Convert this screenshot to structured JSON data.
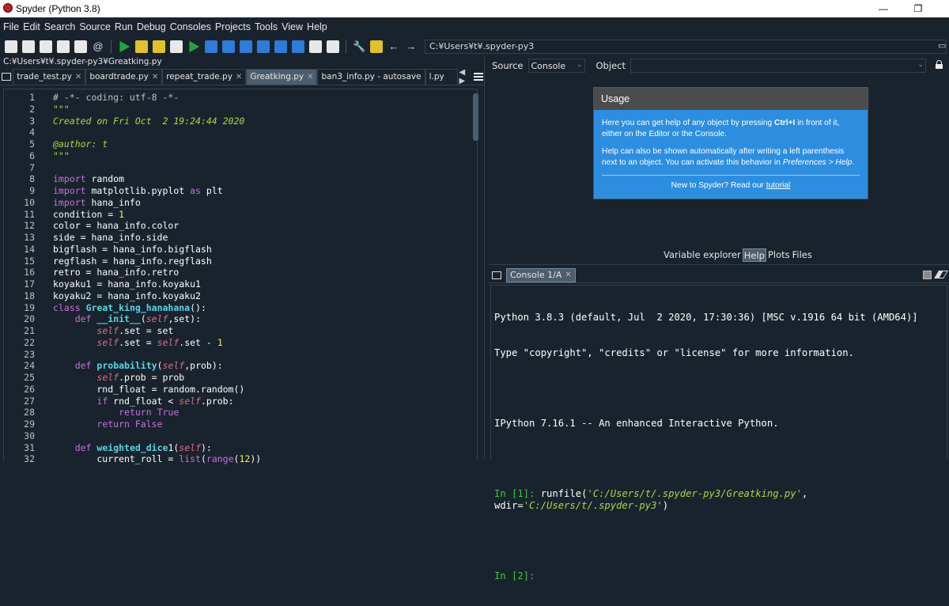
{
  "window": {
    "title": "Spyder (Python 3.8)"
  },
  "menu": [
    "File",
    "Edit",
    "Search",
    "Source",
    "Run",
    "Debug",
    "Consoles",
    "Projects",
    "Tools",
    "View",
    "Help"
  ],
  "toolbar": {
    "path": "C:¥Users¥t¥.spyder-py3"
  },
  "editor": {
    "filepath": "C:¥Users¥t¥.spyder-py3¥Greatking.py",
    "tabs": [
      {
        "label": "trade_test.py",
        "active": false
      },
      {
        "label": "boardtrade.py",
        "active": false
      },
      {
        "label": "repeat_trade.py",
        "active": false
      },
      {
        "label": "Greatking.py",
        "active": true
      },
      {
        "label": "ban3_info.py - autosave",
        "active": false
      },
      {
        "label": "l.py",
        "active": false
      }
    ],
    "line_numbers": [
      "1",
      "2",
      "3",
      "4",
      "5",
      "6",
      "7",
      "8",
      "9",
      "10",
      "11",
      "12",
      "13",
      "14",
      "15",
      "16",
      "17",
      "18",
      "19",
      "20",
      "21",
      "22",
      "23",
      "24",
      "25",
      "26",
      "27",
      "28",
      "29",
      "30",
      "31",
      "32"
    ],
    "code": [
      "# -*- coding: utf-8 -*-",
      "\"\"\"",
      "Created on Fri Oct  2 19:24:44 2020",
      "",
      "@author: t",
      "\"\"\"",
      "",
      "import random",
      "import matplotlib.pyplot as plt",
      "import hana_info",
      "condition = 1",
      "color = hana_info.color",
      "side = hana_info.side",
      "bigflash = hana_info.bigflash",
      "regflash = hana_info.regflash",
      "retro = hana_info.retro",
      "koyaku1 = hana_info.koyaku1",
      "koyaku2 = hana_info.koyaku2",
      "class Great_king_hanahana():",
      "    def __init__(self,set):",
      "        self.set = set",
      "        self.set = self.set - 1",
      "",
      "    def probability(self,prob):",
      "        self.prob = prob",
      "        rnd_float = random.random()",
      "        if rnd_float < self.prob:",
      "            return True",
      "        return False",
      "",
      "    def weighted_dice1(self):",
      "        current_roll = list(range(12))"
    ]
  },
  "help": {
    "source_label": "Source",
    "source_value": "Console",
    "object_label": "Object",
    "usage_title": "Usage",
    "usage_p1_a": "Here you can get help of any object by pressing ",
    "usage_p1_b": "Ctrl+I",
    "usage_p1_c": " in front of it, either on the Editor or the Console.",
    "usage_p2_a": "Help can also be shown automatically after writing a left parenthesis next to an object. You can activate this behavior in ",
    "usage_p2_b": "Preferences > Help",
    "usage_p2_c": ".",
    "usage_foot_a": "New to Spyder? Read our ",
    "usage_foot_link": "tutorial",
    "pane_tabs": [
      "Variable explorer",
      "Help",
      "Plots",
      "Files"
    ]
  },
  "console": {
    "tab_label": "Console 1/A",
    "line1": "Python 3.8.3 (default, Jul  2 2020, 17:30:36) [MSC v.1916 64 bit (AMD64)]",
    "line2": "Type \"copyright\", \"credits\" or \"license\" for more information.",
    "line3": "IPython 7.16.1 -- An enhanced Interactive Python.",
    "prompt1": "In [1]:",
    "cmd1_a": " runfile(",
    "cmd1_str1": "'C:/Users/t/.spyder-py3/Greatking.py'",
    "cmd1_b": ", wdir=",
    "cmd1_str2": "'C:/Users/t/.spyder-py3'",
    "cmd1_c": ")",
    "prompt2": "In [2]:"
  }
}
